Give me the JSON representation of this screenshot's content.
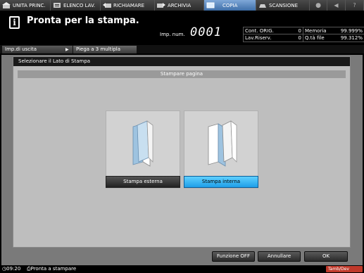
{
  "tabs": [
    {
      "label": "UNITA PRINC.",
      "icon": "home-icon"
    },
    {
      "label": "ELENCO LAV.",
      "icon": "job-list-icon"
    },
    {
      "label": "RICHIAMARE",
      "icon": "recall-icon"
    },
    {
      "label": "ARCHIVIA",
      "icon": "archive-icon"
    },
    {
      "label": "COPIA",
      "icon": "copy-icon",
      "active": true
    },
    {
      "label": "SCANSIONE",
      "icon": "scan-icon"
    }
  ],
  "header": {
    "status_title": "Pronta per la stampa.",
    "copies_label": "Imp. num.",
    "copies_value": "0001",
    "counters": {
      "orig_label": "Cont. ORIG.",
      "orig_value": "0",
      "memory_label": "Memoria",
      "memory_value": "99.999%",
      "reserved_label": "Lav.Riserv.",
      "reserved_value": "0",
      "hdd_label": "Q.tà file",
      "hdd_value": "99.312%"
    }
  },
  "breadcrumb": {
    "item1": "Imp.di uscita",
    "item2": "Piega a 3 multipla"
  },
  "dialog": {
    "title": "Selezionare il Lato di Stampa",
    "section": "Stampare pagina",
    "option_external": "Stampa esterna",
    "option_internal": "Stampa interna",
    "selected": "Stampa interna"
  },
  "buttons": {
    "function_off": "Funzione OFF",
    "cancel": "Annullare",
    "ok": "OK"
  },
  "footer": {
    "time": "09:20",
    "status": "Pronta a stampare",
    "badge": "Tamb/Dev"
  },
  "colors": {
    "selected_button": "#1f9fe8",
    "active_tab": "#3e6ea8",
    "badge": "#c0392b"
  }
}
